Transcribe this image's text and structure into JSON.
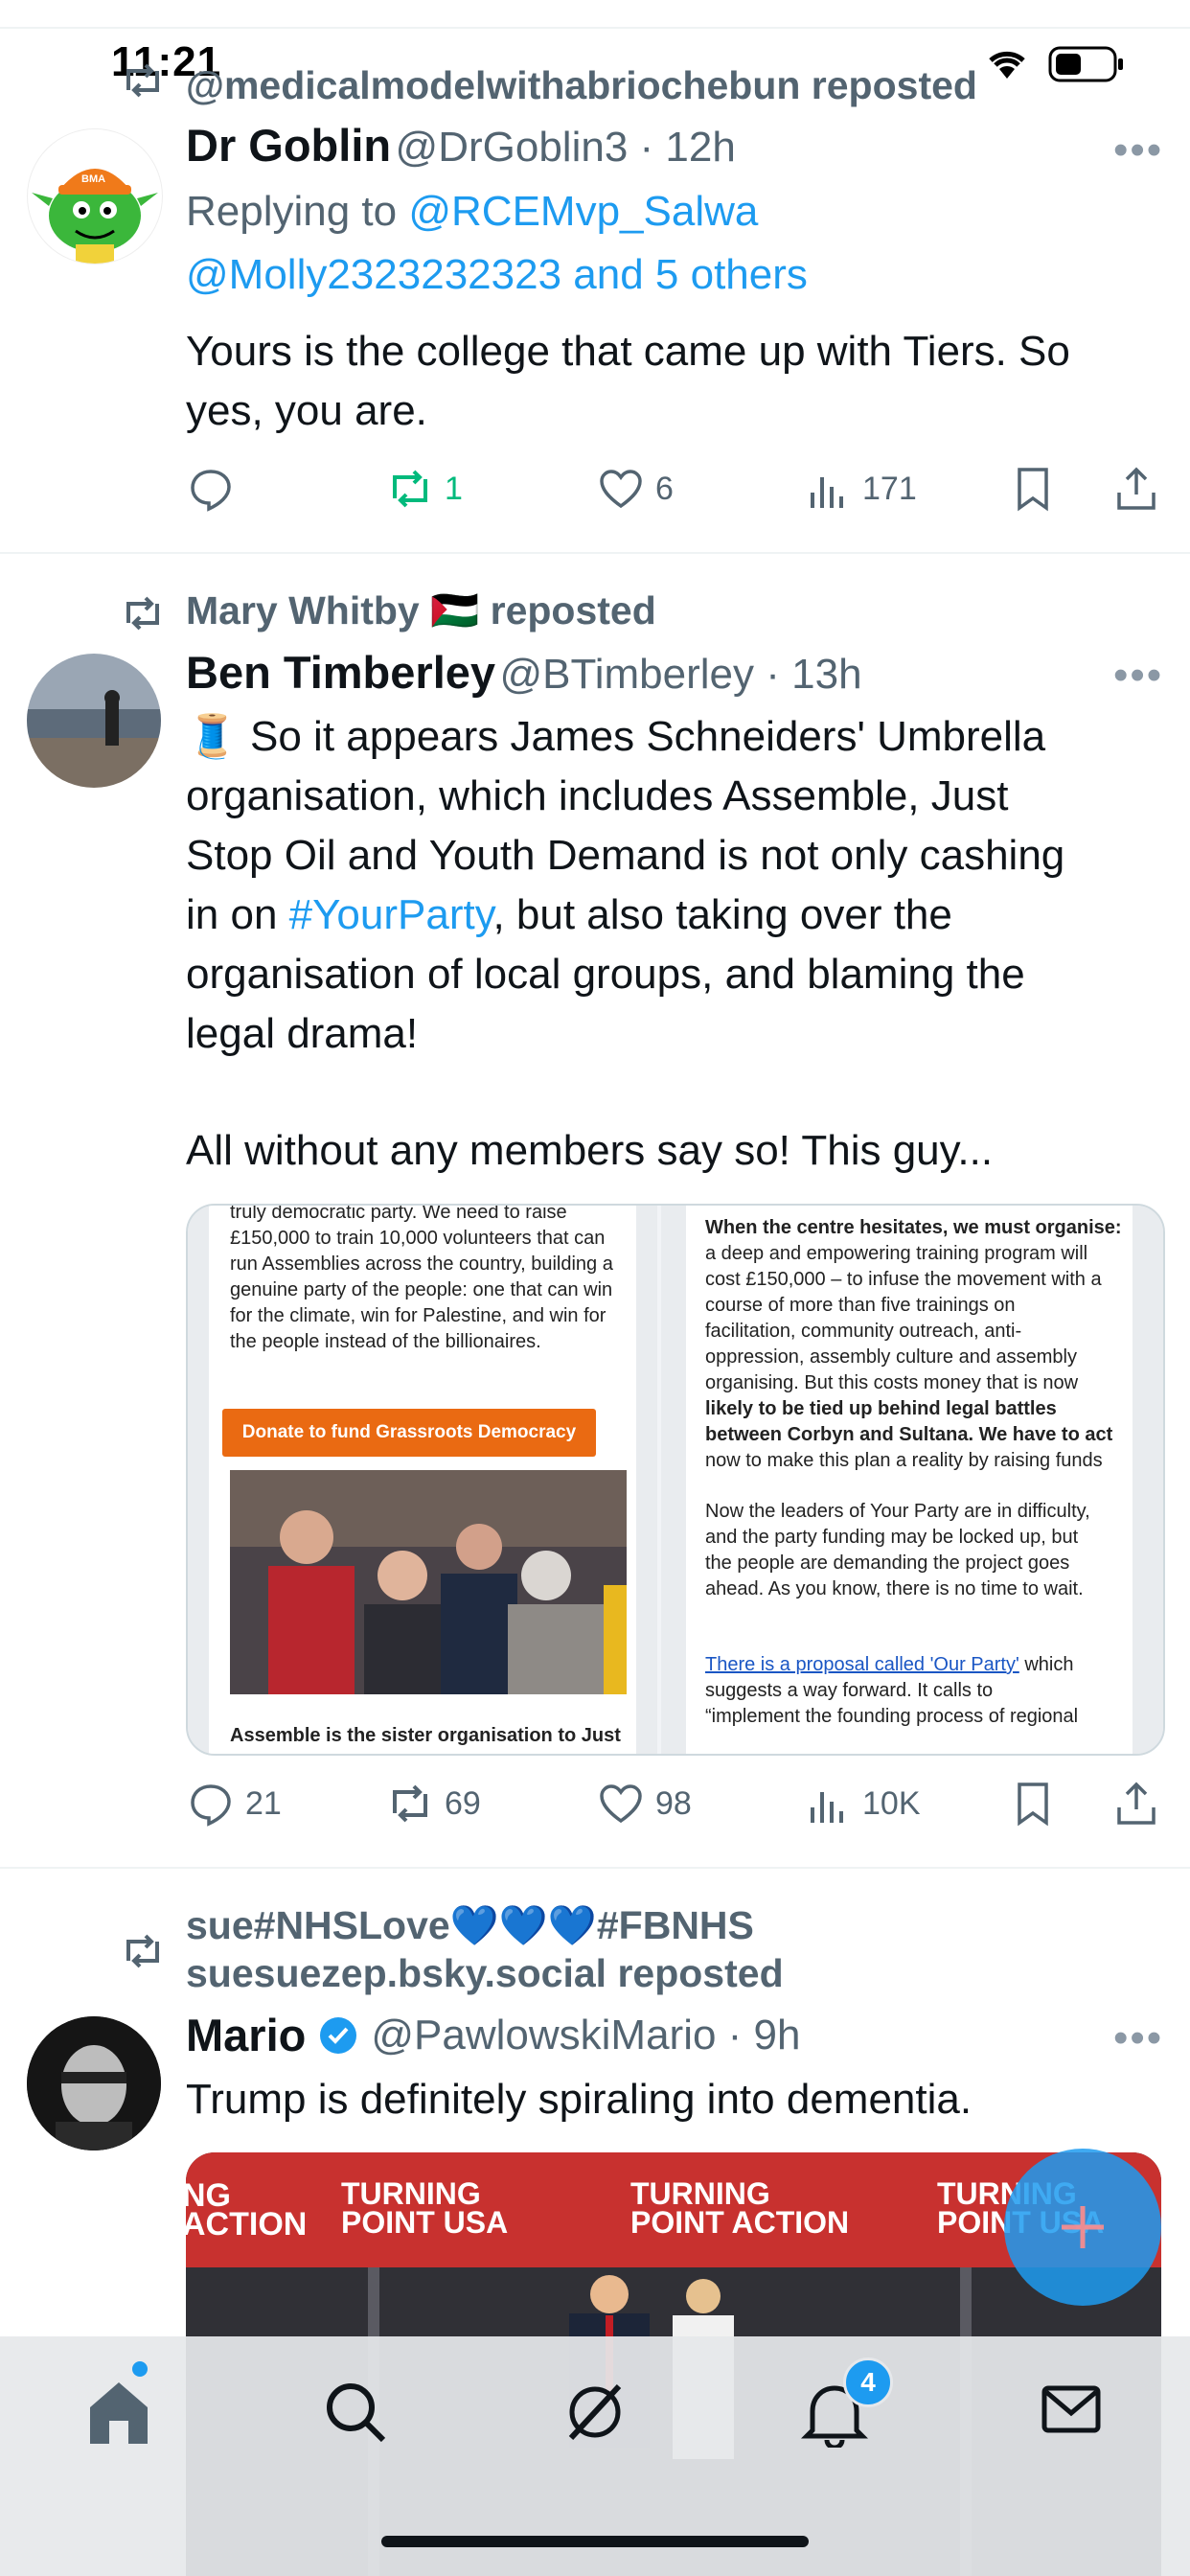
{
  "status_bar": {
    "time": "11:21"
  },
  "tweets": [
    {
      "reposted_by": "@medicalmodelwithabriochebun reposted",
      "name": "Dr Goblin",
      "handle_time": "@DrGoblin3 · 12h",
      "reply_prefix": "Replying to ",
      "reply_user": "@RCEMvp_Salwa",
      "reply_rest": "@Molly2323232323 and 5 others",
      "text_1": "Yours is the college that came up with Tiers. So",
      "text_2": "yes, you are.",
      "reposts": "1",
      "likes": "6",
      "views": "171"
    },
    {
      "reposted_by_name": "Mary Whitby",
      "reposted_by_flag": "🇵🇸",
      "reposted_label": "reposted",
      "name": "Ben Timberley",
      "handle_time": "@BTimberley · 13h",
      "line_1": "🧵 So it appears James Schneiders' Umbrella",
      "line_2": "organisation, which includes Assemble, Just",
      "line_3": "Stop Oil and Youth Demand is not only cashing",
      "line_4_pre": "in on ",
      "line_4_hashtag": "#YourParty",
      "line_4_post": ", but also taking over the",
      "line_5": "organisation of local groups, and blaming the",
      "line_6": "legal drama!",
      "line_7": "All without any members say so! This guy...",
      "replies": "21",
      "reposts": "69",
      "likes": "98",
      "views": "10K",
      "media": {
        "left_top_lines": [
          "truly democratic party. We need to raise",
          "£150,000 to train 10,000 volunteers that can",
          "run Assemblies across the country, building a",
          "genuine party of the people: one that can win",
          "for the climate, win for Palestine, and win for",
          "the people instead of the billionaires."
        ],
        "donate_button": "Donate to fund Grassroots Democracy",
        "left_bottom": "Assemble is the sister organisation to Just",
        "right_p1": [
          "When the centre hesitates, we must organise:",
          "a deep and empowering training program will",
          "cost £150,000 – to infuse the movement with a",
          "course of more than five trainings on",
          "facilitation, community outreach, anti-",
          "oppression, assembly culture and assembly",
          "organising. But this costs money that is now",
          "likely to be tied up behind legal battles",
          "between Corbyn and Sultana. We have to act",
          "now to make this plan a reality by raising funds"
        ],
        "right_p2": [
          "Now the leaders of Your Party are in difficulty,",
          "and the party funding may be locked up, but",
          "the people are demanding the project goes",
          "ahead. As you know, there is no time to wait."
        ],
        "right_p3_link": "There is a proposal called 'Our Party'",
        "right_p3_rest": " which",
        "right_p3": [
          "suggests a way forward. It calls to",
          "“implement the founding process of regional"
        ]
      }
    },
    {
      "reposted_by_1": "sue#NHSLove💙💙💙#FBNHS",
      "reposted_by_2": "suesuezep.bsky.social reposted",
      "name": "Mario",
      "handle_time": "@PawlowskiMario · 9h",
      "text": "Trump is definitely spiraling into dementia.",
      "banner_texts": [
        "TURNING",
        "POINT USA",
        "TURNING",
        "POINT ACTION",
        "TURNING",
        "POINT USA",
        "NG",
        "ACTION"
      ]
    }
  ],
  "tabbar": {
    "notifications_badge": "4"
  },
  "colors": {
    "accent": "#1d9bf0",
    "repost_green": "#00ba7c",
    "text": "#0f1419",
    "muted": "#536471"
  }
}
